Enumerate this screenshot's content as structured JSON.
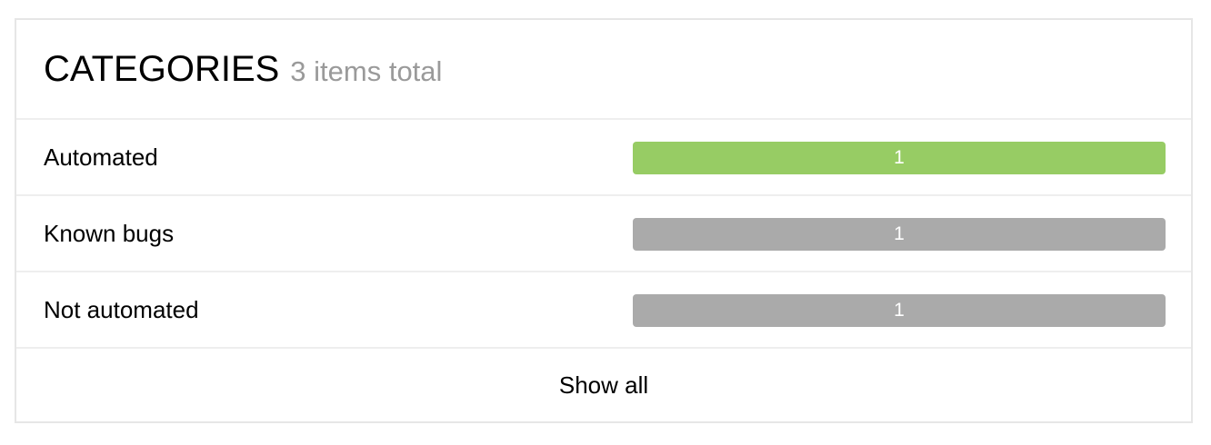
{
  "widget": {
    "title": "CATEGORIES",
    "subtitle": "3 items total",
    "rows": [
      {
        "label": "Automated",
        "count": "1",
        "color": "#97cc64"
      },
      {
        "label": "Known bugs",
        "count": "1",
        "color": "#aaaaaa"
      },
      {
        "label": "Not automated",
        "count": "1",
        "color": "#aaaaaa"
      }
    ],
    "show_all_label": "Show all"
  }
}
